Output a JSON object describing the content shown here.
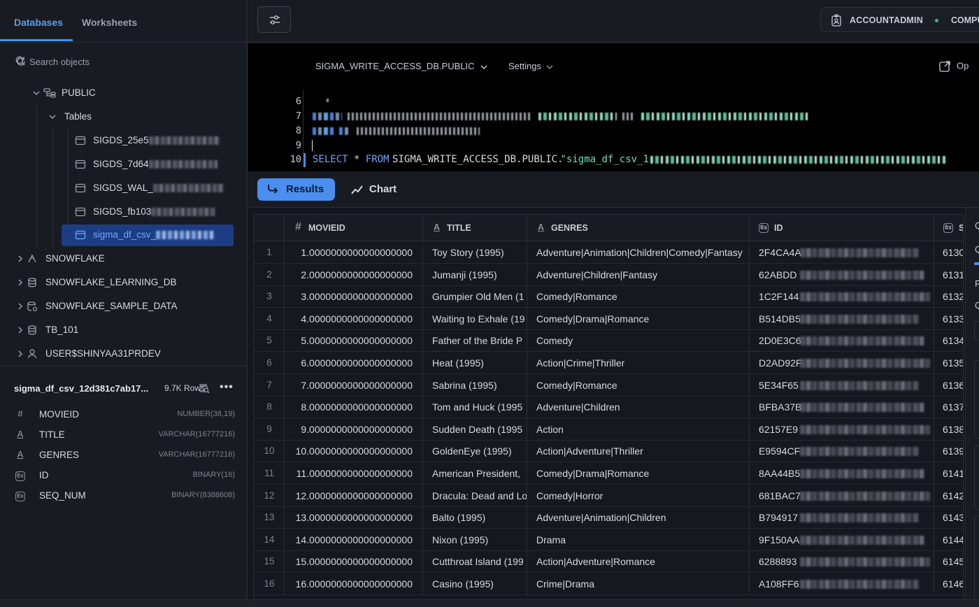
{
  "sidebar": {
    "tabs": [
      {
        "label": "Databases"
      },
      {
        "label": "Worksheets"
      }
    ],
    "search_placeholder": "Search objects",
    "tree": {
      "schema": "PUBLIC",
      "tables_folder": "Tables",
      "tables": [
        {
          "label": "SIGDS_25e5"
        },
        {
          "label": "SIGDS_7d64"
        },
        {
          "label": "SIGDS_WAL_"
        },
        {
          "label": "SIGDS_fb103"
        },
        {
          "label": "sigma_df_csv_"
        }
      ],
      "databases": [
        {
          "label": "SNOWFLAKE",
          "icon": "snowflake-icon"
        },
        {
          "label": "SNOWFLAKE_LEARNING_DB",
          "icon": "database-icon"
        },
        {
          "label": "SNOWFLAKE_SAMPLE_DATA",
          "icon": "shared-database-icon"
        },
        {
          "label": "TB_101",
          "icon": "database-icon"
        },
        {
          "label": "USER$SHINYAA31PRDEV",
          "icon": "user-icon"
        }
      ]
    },
    "details": {
      "name": "sigma_df_csv_12d381c7ab17...",
      "rows": "9.7K Rows",
      "columns": [
        {
          "name": "MOVIEID",
          "type": "NUMBER(38,19)",
          "icon": "#"
        },
        {
          "name": "TITLE",
          "type": "VARCHAR(16777216)",
          "icon": "A"
        },
        {
          "name": "GENRES",
          "type": "VARCHAR(16777216)",
          "icon": "A"
        },
        {
          "name": "ID",
          "type": "BINARY(16)",
          "icon": "0x"
        },
        {
          "name": "SEQ_NUM",
          "type": "BINARY(8388608)",
          "icon": "0x"
        }
      ]
    }
  },
  "topbar": {
    "role": "ACCOUNTADMIN",
    "warehouse": "COMPU"
  },
  "editor": {
    "context": "SIGMA_WRITE_ACCESS_DB.PUBLIC",
    "settings_label": "Settings",
    "open_label": "Op",
    "line_numbers": [
      "6",
      "7",
      "8",
      "9",
      "10"
    ],
    "line10": {
      "kw_select": "SELECT",
      "star": "*",
      "kw_from": "FROM",
      "target": "SIGMA_WRITE_ACCESS_DB.PUBLIC.",
      "string": "\"sigma_df_csv_1"
    }
  },
  "results": {
    "results_label": "Results",
    "chart_label": "Chart"
  },
  "grid": {
    "columns": [
      {
        "name": "MOVIEID",
        "icon": "#"
      },
      {
        "name": "TITLE",
        "icon": "A"
      },
      {
        "name": "GENRES",
        "icon": "A"
      },
      {
        "name": "ID",
        "icon": "0x"
      },
      {
        "name": "S",
        "icon": "0x"
      }
    ],
    "rows": [
      {
        "n": "1",
        "movieid": "1.0000000000000000000",
        "title": "Toy Story (1995)",
        "genres": "Adventure|Animation|Children|Comedy|Fantasy",
        "id": "2F4CA4A",
        "seq": "6130"
      },
      {
        "n": "2",
        "movieid": "2.0000000000000000000",
        "title": "Jumanji (1995)",
        "genres": "Adventure|Children|Fantasy",
        "id": "62ABDD",
        "seq": "6131"
      },
      {
        "n": "3",
        "movieid": "3.0000000000000000000",
        "title": "Grumpier Old Men (1",
        "genres": "Comedy|Romance",
        "id": "1C2F144",
        "seq": "6132"
      },
      {
        "n": "4",
        "movieid": "4.0000000000000000000",
        "title": "Waiting to Exhale (19",
        "genres": "Comedy|Drama|Romance",
        "id": "B514DB5",
        "seq": "6133"
      },
      {
        "n": "5",
        "movieid": "5.0000000000000000000",
        "title": "Father of the Bride P",
        "genres": "Comedy",
        "id": "2D0E3C6",
        "seq": "6134"
      },
      {
        "n": "6",
        "movieid": "6.0000000000000000000",
        "title": "Heat (1995)",
        "genres": "Action|Crime|Thriller",
        "id": "D2AD92F",
        "seq": "6135"
      },
      {
        "n": "7",
        "movieid": "7.0000000000000000000",
        "title": "Sabrina (1995)",
        "genres": "Comedy|Romance",
        "id": "5E34F65",
        "seq": "6136"
      },
      {
        "n": "8",
        "movieid": "8.0000000000000000000",
        "title": "Tom and Huck (1995",
        "genres": "Adventure|Children",
        "id": "BFBA37B",
        "seq": "6137"
      },
      {
        "n": "9",
        "movieid": "9.0000000000000000000",
        "title": "Sudden Death (1995",
        "genres": "Action",
        "id": "62157E9",
        "seq": "6138"
      },
      {
        "n": "10",
        "movieid": "10.0000000000000000000",
        "title": "GoldenEye (1995)",
        "genres": "Action|Adventure|Thriller",
        "id": "E9594CF",
        "seq": "6139"
      },
      {
        "n": "11",
        "movieid": "11.0000000000000000000",
        "title": "American President, ",
        "genres": "Comedy|Drama|Romance",
        "id": "8AA44B5",
        "seq": "6141"
      },
      {
        "n": "12",
        "movieid": "12.0000000000000000000",
        "title": "Dracula: Dead and Lo",
        "genres": "Comedy|Horror",
        "id": "681BAC7",
        "seq": "6142"
      },
      {
        "n": "13",
        "movieid": "13.0000000000000000000",
        "title": "Balto (1995)",
        "genres": "Adventure|Animation|Children",
        "id": "B794917",
        "seq": "6143"
      },
      {
        "n": "14",
        "movieid": "14.0000000000000000000",
        "title": "Nixon (1995)",
        "genres": "Drama",
        "id": "9F150AA",
        "seq": "6144"
      },
      {
        "n": "15",
        "movieid": "15.0000000000000000000",
        "title": "Cutthroat Island (199",
        "genres": "Action|Adventure|Romance",
        "id": "6288893",
        "seq": "6145"
      },
      {
        "n": "16",
        "movieid": "16.0000000000000000000",
        "title": "Casino (1995)",
        "genres": "Crime|Drama",
        "id": "A108FF6",
        "seq": "6146"
      }
    ]
  },
  "right_panel": {
    "letters": [
      "Q",
      "Q",
      "R",
      "Q"
    ]
  },
  "colors": {
    "accent": "#4a8ff0",
    "selection": "#1c3d83",
    "string": "#72e0b4",
    "keyword": "#6aa4ff",
    "status_ok": "#28c07a"
  }
}
